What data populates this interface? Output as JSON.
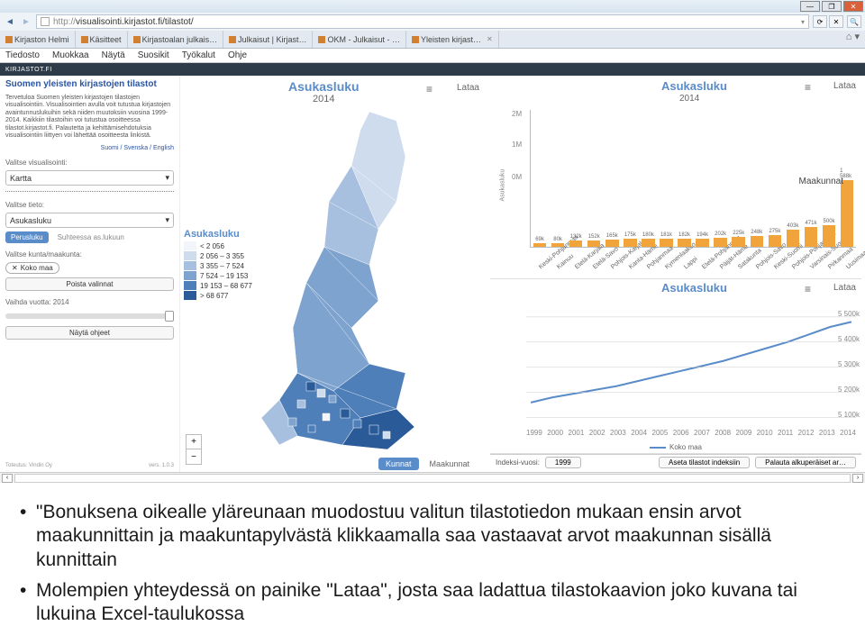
{
  "browser": {
    "url_prefix": "http://",
    "url_rest": "visualisointi.kirjastot.fi/tilastot/",
    "tabs": [
      "Kirjaston Helmi",
      "Käsitteet",
      "Kirjastoalan julkais…",
      "Julkaisut | Kirjast…",
      "OKM - Julkaisut - …",
      "Yleisten kirjast…"
    ],
    "menus": [
      "Tiedosto",
      "Muokkaa",
      "Näytä",
      "Suosikit",
      "Työkalut",
      "Ohje"
    ],
    "brand": "KIRJASTOT.FI"
  },
  "sidebar": {
    "title": "Suomen yleisten kirjastojen tilastot",
    "desc": "Tervetuloa Suomen yleisten kirjastojen tilastojen visualisointiin. Visualisointien avulla voit tutustua kirjastojen avaintunnuslukuihin sekä niiden muutoksiin vuosina 1999-2014. Kaikkiin tilastoihin voi tutustua osoitteessa tilastot.kirjastot.fi. Palautetta ja kehittämisehdotuksia visualisointiin liittyen voi lähettää osoitteesta linkistä.",
    "langs": "Suomi / Svenska / English",
    "visLabel": "Valitse visualisointi:",
    "visValue": "Kartta",
    "tietoLabel": "Valitse tieto:",
    "tietoValue": "Asukasluku",
    "pillA": "Perusluku",
    "pillB": "Suhteessa as.lukuun",
    "kuntaLabel": "Valitse kunta/maakunta:",
    "chip": "Koko maa",
    "clear": "Poista valinnat",
    "yearLabel": "Vaihda vuotta: 2014",
    "guide": "Näytä ohjeet",
    "credit": "Toteutus: Vindin Oy",
    "vers": "vers. 1.0.3"
  },
  "map": {
    "title": "Asukasluku",
    "year": "2014",
    "lataa": "Lataa",
    "legendTitle": "Asukasluku",
    "legend": [
      {
        "c": "#f2f5fa",
        "t": "< 2 056"
      },
      {
        "c": "#cfdced",
        "t": "2 056 – 3 355"
      },
      {
        "c": "#a8c0df",
        "t": "3 355 – 7 524"
      },
      {
        "c": "#7ea3cf",
        "t": "7 524 – 19 153"
      },
      {
        "c": "#4f7fb8",
        "t": "19 153 – 68 677"
      },
      {
        "c": "#2b5a99",
        "t": "> 68 677"
      }
    ],
    "toggleOn": "Kunnat",
    "toggleOff": "Maakunnat"
  },
  "chart_data": [
    {
      "type": "bar",
      "title": "Asukasluku",
      "subtitle": "2014",
      "ylabel": "Asukasluku",
      "ylim": [
        0,
        2000000
      ],
      "yticks": [
        "0M",
        "1M",
        "2M"
      ],
      "categories": [
        "Keski-Pohjanmaa",
        "Kainuu",
        "Etelä-Karjala",
        "Etelä-Savo",
        "Pohjois-Karjala",
        "Kanta-Häme",
        "Pohjanmaa",
        "Kymenlaakso",
        "Lappi",
        "Etelä-Pohjanmaa",
        "Päijät-Häme",
        "Satakunta",
        "Pohjois-Savo",
        "Keski-Suomi",
        "Pohjois-Pohjanmaa",
        "Varsinais-Suomi",
        "Pirkanmaa",
        "Uusimaa"
      ],
      "values_label": [
        "69k",
        "80k",
        "132k",
        "152k",
        "165k",
        "175k",
        "180k",
        "181k",
        "182k",
        "194k",
        "202k",
        "225k",
        "248k",
        "275k",
        "403k",
        "471k",
        "500k",
        "1 588k"
      ],
      "values": [
        69,
        80,
        132,
        152,
        165,
        175,
        180,
        181,
        182,
        194,
        202,
        225,
        248,
        275,
        403,
        471,
        500,
        1588
      ],
      "footer_label": "Maakunnat",
      "lataa": "Lataa"
    },
    {
      "type": "line",
      "title": "Asukasluku",
      "lataa": "Lataa",
      "x": [
        1999,
        2000,
        2001,
        2002,
        2003,
        2004,
        2005,
        2006,
        2007,
        2008,
        2009,
        2010,
        2011,
        2012,
        2013,
        2014
      ],
      "series": [
        {
          "name": "Koko maa",
          "values": [
            5160,
            5180,
            5195,
            5210,
            5225,
            5245,
            5265,
            5285,
            5305,
            5325,
            5350,
            5375,
            5400,
            5430,
            5460,
            5480
          ]
        }
      ],
      "ylim": [
        5100000,
        5500000
      ],
      "yticks": [
        "5 100k",
        "5 200k",
        "5 300k",
        "5 400k",
        "5 500k"
      ]
    }
  ],
  "chartfooter": {
    "idxlabel": "Indeksi-vuosi:",
    "idxval": "1999",
    "set": "Aseta tilastot indeksiin",
    "reset": "Palauta alkuperäiset ar…"
  },
  "slide": {
    "b1": "\"Bonuksena oikealle yläreunaan muodostuu valitun tilastotiedon mukaan ensin arvot maakunnittain ja maakuntapylvästä klikkaamalla saa vastaavat arvot maakunnan sisällä kunnittain",
    "b2": "Molempien yhteydessä on painike \"Lataa\", josta saa ladattua tilastokaavion joko kuvana tai lukuina Excel-taulukossa"
  }
}
